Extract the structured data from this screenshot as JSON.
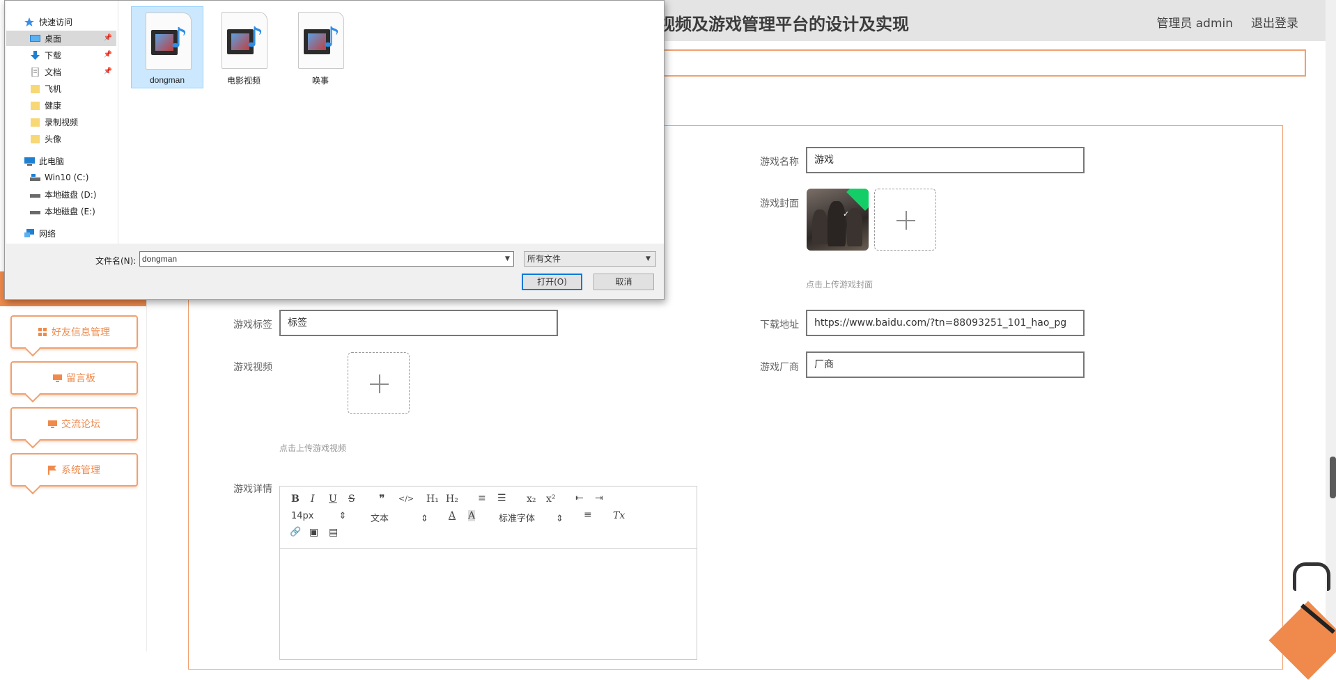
{
  "header": {
    "title": "视频及游戏管理平台的设计及实现",
    "user": "管理员 admin",
    "logout": "退出登录"
  },
  "sidebar": {
    "items": [
      {
        "label": "好友信息管理",
        "icon": "grid-icon"
      },
      {
        "label": "留言板",
        "icon": "monitor-icon"
      },
      {
        "label": "交流论坛",
        "icon": "monitor-icon"
      },
      {
        "label": "系统管理",
        "icon": "flag-icon"
      }
    ]
  },
  "form": {
    "game_name_label": "游戏名称",
    "game_name_value": "游戏",
    "game_cover_label": "游戏封面",
    "game_cover_hint": "点击上传游戏封面",
    "game_tag_label": "游戏标签",
    "game_tag_value": "标签",
    "download_label": "下载地址",
    "download_value": "https://www.baidu.com/?tn=88093251_101_hao_pg",
    "game_video_label": "游戏视频",
    "game_video_hint": "点击上传游戏视频",
    "vendor_label": "游戏厂商",
    "vendor_value": "厂商",
    "detail_label": "游戏详情"
  },
  "editor": {
    "font_size": "14px",
    "text_style": "文本",
    "font_family": "标准字体",
    "buttons": {
      "bold": "B",
      "italic": "I",
      "underline": "U",
      "strike": "S",
      "quote": "❞",
      "code": "</>",
      "h1": "H₁",
      "h2": "H₂",
      "ordered": "≡",
      "bullet": "☰",
      "sub": "x₂",
      "sup": "x²",
      "outdent": "⇤",
      "indent": "⇥",
      "color": "A",
      "bg": "A",
      "align": "≡",
      "clear": "Tx",
      "link": "🔗",
      "image": "▣",
      "video": "▤"
    }
  },
  "dialog": {
    "nav": [
      {
        "label": "快速访问",
        "icon": "star-icon",
        "level": 0
      },
      {
        "label": "桌面",
        "icon": "desktop-icon",
        "level": 1,
        "pinned": true,
        "selected": true
      },
      {
        "label": "下载",
        "icon": "download-icon",
        "level": 1,
        "pinned": true
      },
      {
        "label": "文档",
        "icon": "document-icon",
        "level": 1,
        "pinned": true
      },
      {
        "label": "飞机",
        "icon": "folder-icon",
        "level": 1
      },
      {
        "label": "健康",
        "icon": "folder-icon",
        "level": 1
      },
      {
        "label": "录制视频",
        "icon": "folder-icon",
        "level": 1
      },
      {
        "label": "头像",
        "icon": "folder-icon",
        "level": 1
      },
      {
        "label": "此电脑",
        "icon": "computer-icon",
        "level": 0
      },
      {
        "label": "Win10 (C:)",
        "icon": "drive-icon",
        "level": 1
      },
      {
        "label": "本地磁盘 (D:)",
        "icon": "drive-icon",
        "level": 1
      },
      {
        "label": "本地磁盘 (E:)",
        "icon": "drive-icon",
        "level": 1
      },
      {
        "label": "网络",
        "icon": "network-icon",
        "level": 0
      }
    ],
    "files": [
      {
        "name": "dongman",
        "selected": true
      },
      {
        "name": "电影视频",
        "selected": false
      },
      {
        "name": "唤事",
        "selected": false
      }
    ],
    "filename_label": "文件名(N):",
    "filename_value": "dongman",
    "filetype_value": "所有文件",
    "open_button": "打开(O)",
    "cancel_button": "取消"
  },
  "colors": {
    "accent": "#ef8a4c",
    "header_bg": "#e4e4e4",
    "selection": "#cce8ff"
  }
}
